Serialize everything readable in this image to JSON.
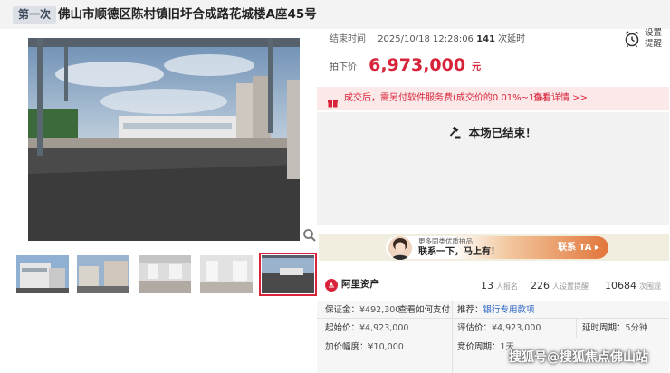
{
  "header": {
    "round_badge": "第一次",
    "title": "佛山市顺德区陈村镇旧圩合成路花城楼A座45号"
  },
  "auction": {
    "end_label": "结束时间",
    "end_time": "2025/10/18 12:28:06",
    "extend_count": "141",
    "extend_label": "次延时",
    "remind_label": "设置提醒",
    "price_label": "拍下价",
    "price_value": "6,973,000",
    "price_unit": "元",
    "fee_text": "成交后，需另付软件服务费(成交价的0.01%~1%)",
    "fee_link": "查看详情 >>",
    "ended_text": "本场已结束！"
  },
  "contact": {
    "sub_text": "更多同类优质拍品",
    "main_text": "联系一下，马上有！",
    "button_label": "联系 TA",
    "button_arrow": "▸"
  },
  "platform": {
    "name": "阿里资产",
    "stats": [
      {
        "value": "13",
        "label": "人报名"
      },
      {
        "value": "226",
        "label": "人设置提醒"
      },
      {
        "value": "10684",
        "label": "次围观"
      }
    ]
  },
  "details": {
    "deposit_label": "保证金：",
    "deposit_value": "¥492,300",
    "deposit_link": "查看如何支付",
    "recommend_label": "推荐：",
    "recommend_link": "银行专用款项",
    "start_label": "起始价：",
    "start_value": "¥4,923,000",
    "assess_label": "评估价：",
    "assess_value": "¥4,923,000",
    "delay_label": "延时周期：",
    "delay_value": "5分钟",
    "increment_label": "加价幅度：",
    "increment_value": "¥10,000",
    "bidcycle_label": "竞价周期：",
    "bidcycle_value": "1天"
  },
  "watermark": "搜狐号@搜狐焦点佛山站",
  "colors": {
    "accent_red": "#d8243a",
    "link_blue": "#2a64c4",
    "fee_bg": "#fbe9ea",
    "ended_bg": "#f2f2f2",
    "contact_orange": "#e2763b"
  }
}
